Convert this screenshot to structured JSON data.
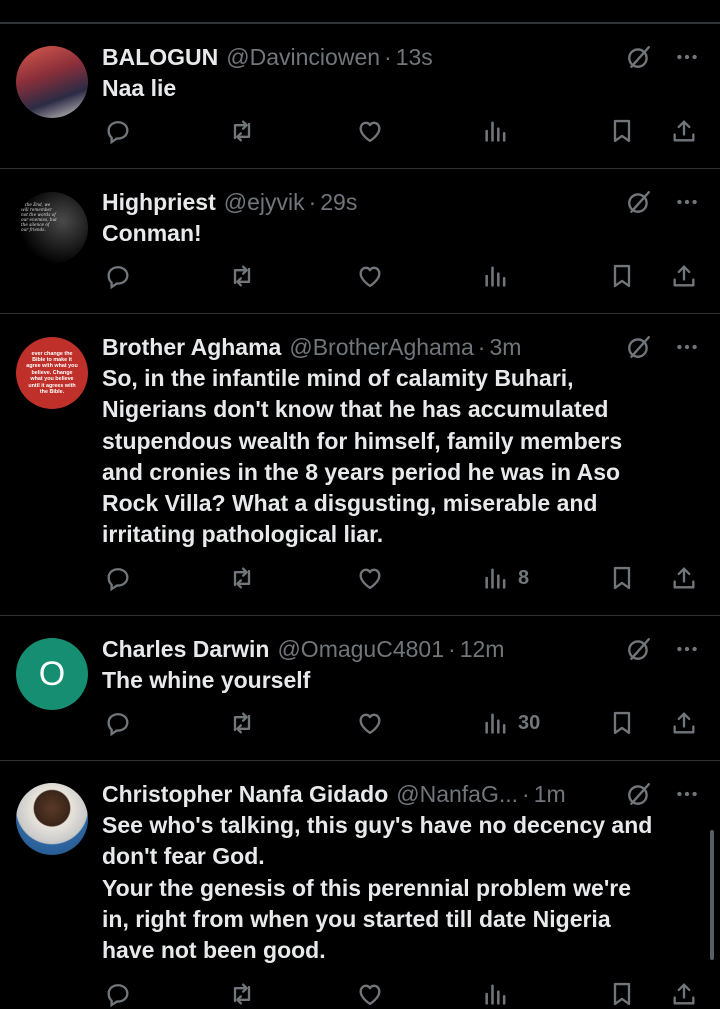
{
  "tweets": [
    {
      "name": "BALOGUN",
      "handle": "@Davinciowen",
      "time": "13s",
      "text": "Naa lie",
      "views": ""
    },
    {
      "name": "Highpriest",
      "handle": "@ejyvik",
      "time": "29s",
      "text": "Conman!",
      "views": "",
      "avatar_text": "n the End, we will remember not the words of our enemies, but the silence of our friends."
    },
    {
      "name": "Brother Aghama",
      "handle": "@BrotherAghama",
      "time": "3m",
      "text": "So, in the infantile mind of calamity Buhari,\nNigerians don't know that he has accumulated\nstupendous wealth for himself, family members\nand cronies in the 8 years period he was in Aso\nRock Villa? What a disgusting, miserable and\nirritating pathological liar.",
      "views": "8",
      "avatar_text": "ever change the Bible to make it agree with what you believe. Change what you believe until it agrees with the Bible."
    },
    {
      "name": "Charles Darwin",
      "handle": "@OmaguC4801",
      "time": "12m",
      "text": "The whine yourself",
      "views": "30",
      "avatar_letter": "O"
    },
    {
      "name": "Christopher Nanfa Gidado",
      "handle": "@NanfaG...",
      "time": "1m",
      "text": "See who's talking, this guy's have no decency and\ndon't fear God.\nYour the genesis of this perennial problem we're\nin, right from when you started till date Nigeria\nhave not been good.",
      "views": ""
    }
  ],
  "separator": "·",
  "colors": {
    "background": "#000000",
    "divider": "#2f3336",
    "text_primary": "#e7e9ea",
    "text_secondary": "#71767b",
    "avatar_teal": "#168e72",
    "avatar_red": "#c0302a"
  },
  "icons": [
    "grok-icon",
    "more-icon",
    "reply-icon",
    "retweet-icon",
    "like-icon",
    "views-icon",
    "bookmark-icon",
    "share-icon"
  ]
}
